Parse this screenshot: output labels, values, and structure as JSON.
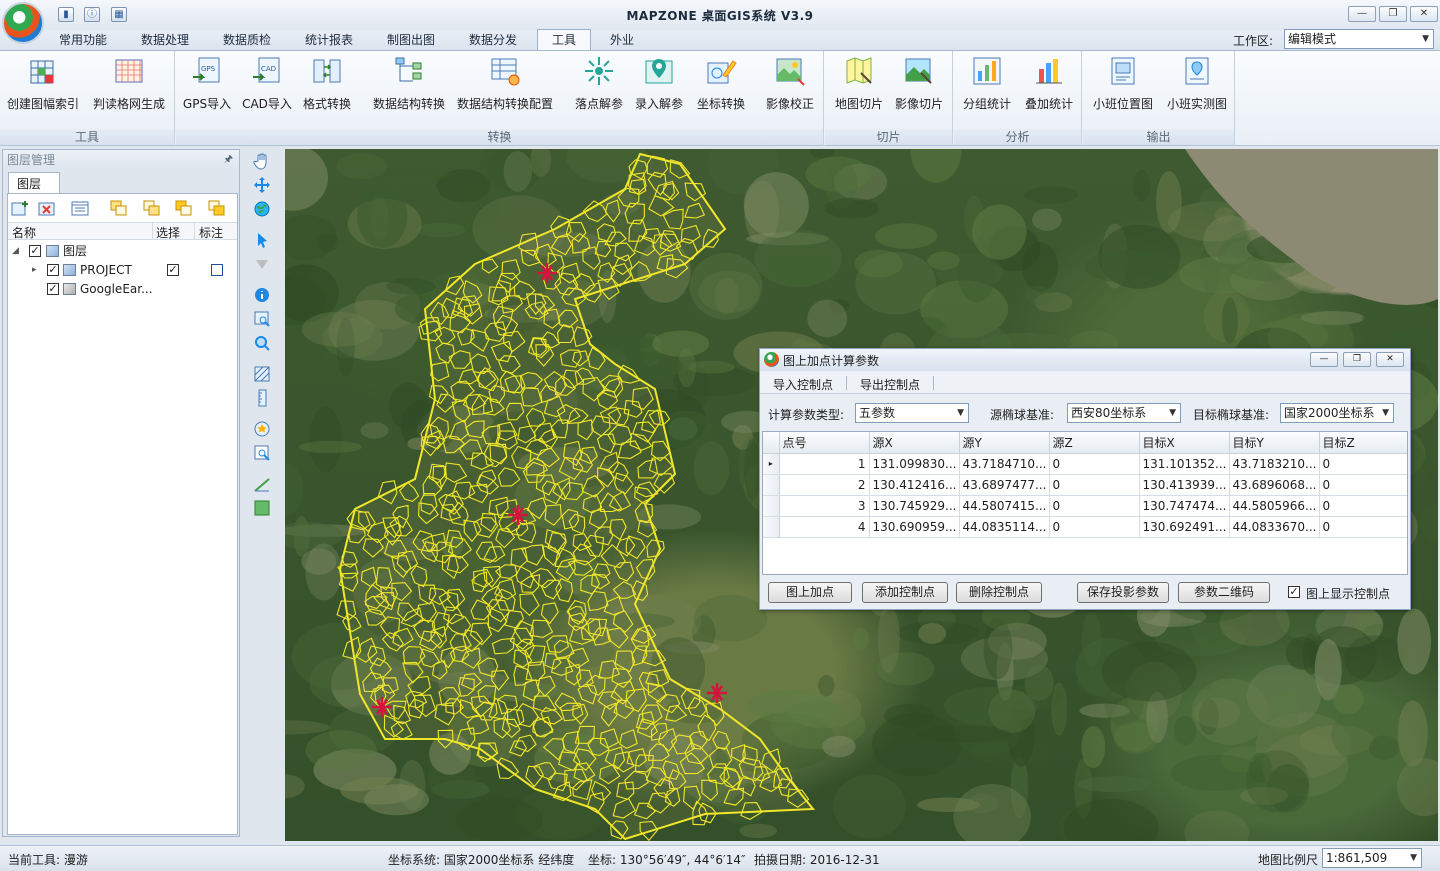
{
  "window": {
    "title": "MAPZONE 桌面GIS系统 V3.9",
    "controls": [
      "—",
      "❐",
      "✕"
    ]
  },
  "ribbon_tabs": [
    {
      "label": "常用功能"
    },
    {
      "label": "数据处理"
    },
    {
      "label": "数据质检"
    },
    {
      "label": "统计报表"
    },
    {
      "label": "制图出图"
    },
    {
      "label": "数据分发"
    },
    {
      "label": "工具",
      "active": true
    },
    {
      "label": "外业"
    }
  ],
  "workspace": {
    "label": "工作区:",
    "value": "编辑模式"
  },
  "ribbon_groups": [
    {
      "label": "工具",
      "buttons": [
        "创建图幅索引",
        "判读格网生成"
      ]
    },
    {
      "label": "转换",
      "buttons": [
        "GPS导入",
        "CAD导入",
        "格式转换",
        "数据结构转换",
        "数据结构转换配置",
        "落点解参",
        "录入解参",
        "坐标转换"
      ]
    },
    {
      "label": "",
      "buttons": [
        "影像校正"
      ]
    },
    {
      "label": "切片",
      "buttons": [
        "地图切片",
        "影像切片"
      ]
    },
    {
      "label": "分析",
      "buttons": [
        "分组统计",
        "叠加统计"
      ]
    },
    {
      "label": "输出",
      "buttons": [
        "小班位置图",
        "小班实测图"
      ]
    }
  ],
  "icon_badges": {
    "gps": "GPS",
    "cad": "CAD"
  },
  "layer_panel": {
    "title": "图层管理",
    "pin": "🖈",
    "tab": "图层",
    "columns": [
      "名称",
      "选择",
      "标注"
    ],
    "root": {
      "label": "图层",
      "checked": true
    },
    "layers": [
      {
        "name": "PROJECT",
        "visible": true,
        "selectable": true,
        "label": false
      },
      {
        "name": "GoogleEar...",
        "visible": true
      }
    ]
  },
  "dialog": {
    "title": "图上加点计算参数",
    "menu": [
      "导入控制点",
      "导出控制点"
    ],
    "params": {
      "calc_type_label": "计算参数类型:",
      "calc_type_value": "五参数",
      "source_label": "源椭球基准:",
      "source_value": "西安80坐标系",
      "target_label": "目标椭球基准:",
      "target_value": "国家2000坐标系"
    },
    "grid": {
      "columns": [
        "点号",
        "源X",
        "源Y",
        "源Z",
        "目标X",
        "目标Y",
        "目标Z"
      ],
      "current_row_marker": "▸",
      "rows": [
        [
          "1",
          "131.099830...",
          "43.7184710...",
          "0",
          "131.101352...",
          "43.7183210...",
          "0"
        ],
        [
          "2",
          "130.412416...",
          "43.6897477...",
          "0",
          "130.413939...",
          "43.6896068...",
          "0"
        ],
        [
          "3",
          "130.745929...",
          "44.5807415...",
          "0",
          "130.747474...",
          "44.5805966...",
          "0"
        ],
        [
          "4",
          "130.690959...",
          "44.0835114...",
          "0",
          "130.692491...",
          "44.0833670...",
          "0"
        ]
      ]
    },
    "buttons": [
      "图上加点",
      "添加控制点",
      "删除控制点",
      "保存投影参数",
      "参数二维码"
    ],
    "show_points_label": "图上显示控制点",
    "show_points_checked": true
  },
  "status": {
    "current_tool": "当前工具:  漫游",
    "coord_system": "坐标系统:  国家2000坐标系  经纬度",
    "coordinates": "坐标:  130°56′49″,  44°6′14″",
    "capture_date": "拍摄日期:  2016-12-31",
    "scale_label": "地图比例尺",
    "scale_value": "1:861,509"
  },
  "colors": {
    "parcel_line": "#f2e62a",
    "control_marker": "#d4143c",
    "ribbon_bg": "#eef3f9"
  }
}
